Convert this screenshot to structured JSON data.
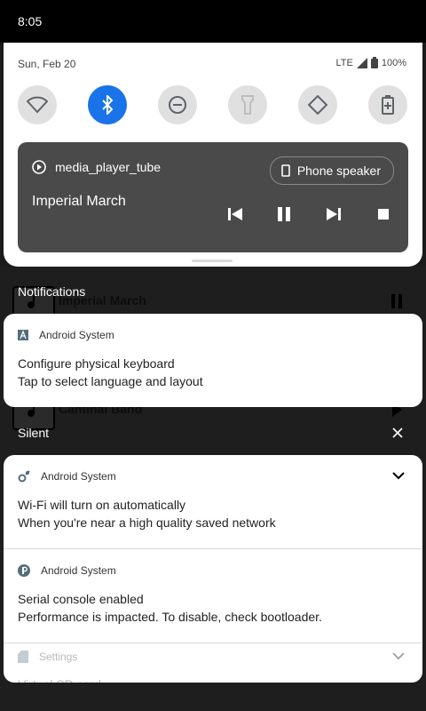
{
  "status_bar": {
    "time": "8:05"
  },
  "quick_settings": {
    "date": "Sun, Feb 20",
    "network": "LTE",
    "battery": "100%",
    "tiles": [
      {
        "name": "wifi-icon",
        "active": false
      },
      {
        "name": "bluetooth-icon",
        "active": true
      },
      {
        "name": "do-not-disturb-icon",
        "active": false
      },
      {
        "name": "flashlight-icon",
        "active": false
      },
      {
        "name": "auto-rotate-icon",
        "active": false
      },
      {
        "name": "battery-saver-icon",
        "active": false
      }
    ],
    "media": {
      "app_name": "media_player_tube",
      "track_title": "Imperial March",
      "output_label": "Phone speaker"
    }
  },
  "background_app": {
    "rows": [
      "Imperial March",
      "Cantinal Band"
    ]
  },
  "sections": {
    "notifications_label": "Notifications",
    "silent_label": "Silent"
  },
  "notifications": [
    {
      "app": "Android System",
      "title": "Configure physical keyboard",
      "text": "Tap to select language and layout"
    },
    {
      "app": "Android System",
      "title": "Wi-Fi will turn on automatically",
      "text": "When you're near a high quality saved network"
    },
    {
      "app": "Android System",
      "title": "Serial console enabled",
      "text": "Performance is impacted. To disable, check bootloader."
    },
    {
      "app": "Settings",
      "title": "Virtual SD card",
      "text": ""
    }
  ],
  "colors": {
    "accent": "#1a73e8",
    "media_bg": "#4a4a4a"
  }
}
